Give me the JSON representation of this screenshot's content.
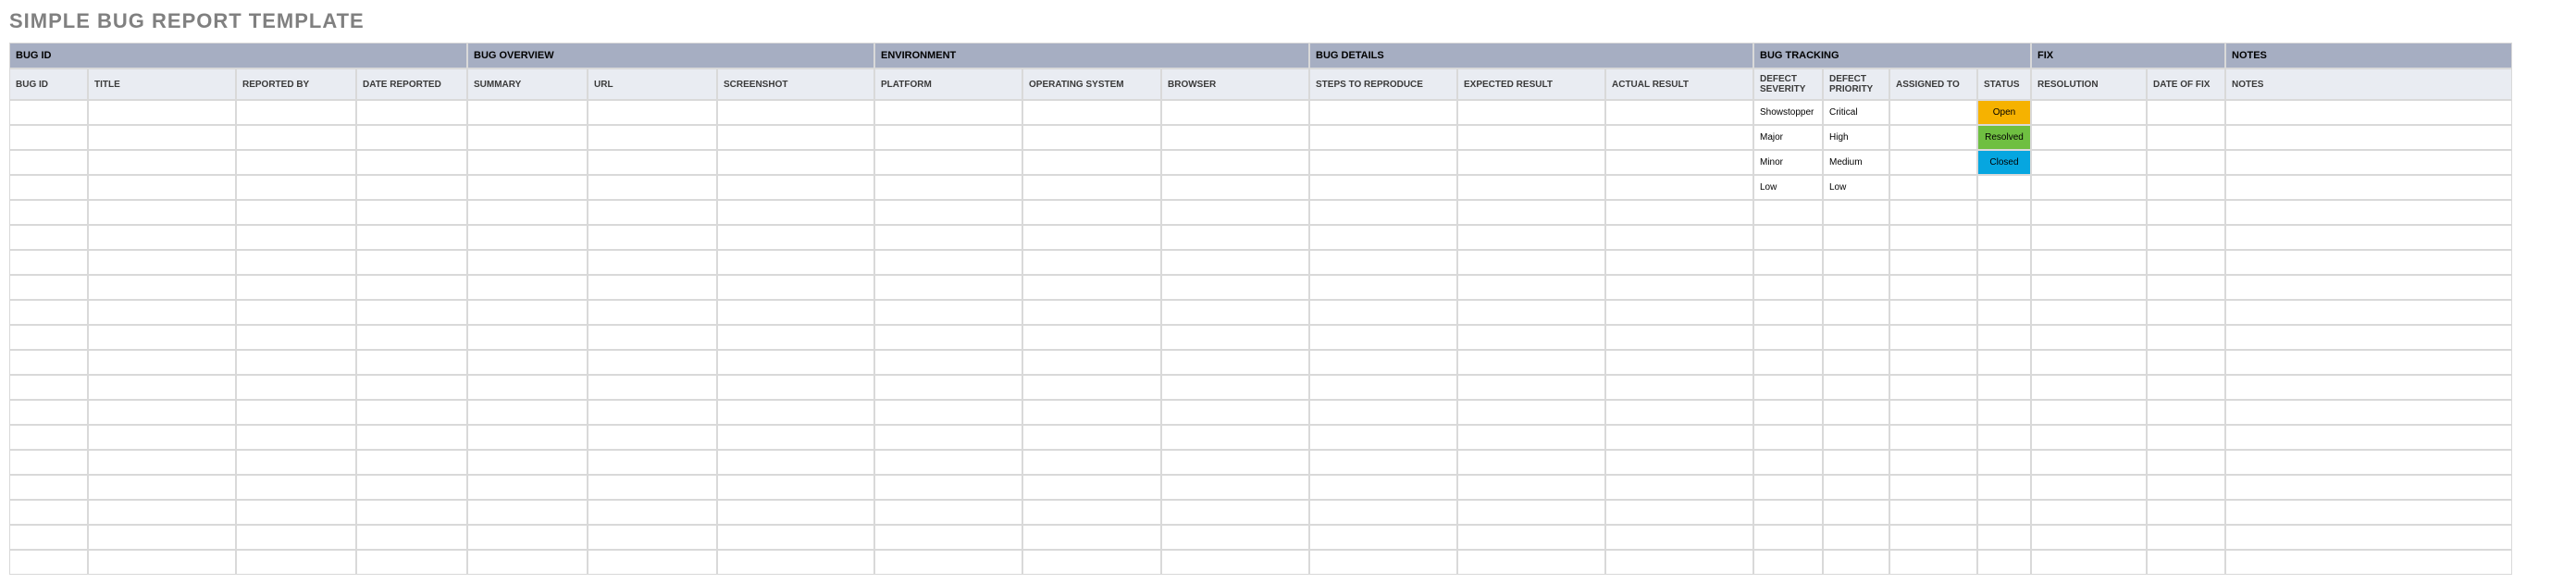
{
  "title": "SIMPLE BUG REPORT TEMPLATE",
  "groupHeaders": {
    "bugId": "BUG ID",
    "bugOverview": "BUG OVERVIEW",
    "environment": "ENVIRONMENT",
    "bugDetails": "BUG DETAILS",
    "bugTracking": "BUG TRACKING",
    "fix": "FIX",
    "notes": "NOTES"
  },
  "columnHeaders": {
    "bugId": "BUG ID",
    "title": "TITLE",
    "reportedBy": "REPORTED BY",
    "dateReported": "DATE REPORTED",
    "summary": "SUMMARY",
    "url": "URL",
    "screenshot": "SCREENSHOT",
    "platform": "PLATFORM",
    "operatingSystem": "OPERATING SYSTEM",
    "browser": "BROWSER",
    "stepsToReproduce": "STEPS TO REPRODUCE",
    "expectedResult": "EXPECTED RESULT",
    "actualResult": "ACTUAL RESULT",
    "defectSeverity": "DEFECT SEVERITY",
    "defectPriority": "DEFECT PRIORITY",
    "assignedTo": "ASSIGNED TO",
    "status": "STATUS",
    "resolution": "RESOLUTION",
    "dateOfFix": "DATE OF FIX",
    "notes": "NOTES"
  },
  "rows": [
    {
      "defectSeverity": "Showstopper",
      "defectPriority": "Critical",
      "status": "Open",
      "statusClass": "status-open"
    },
    {
      "defectSeverity": "Major",
      "defectPriority": "High",
      "status": "Resolved",
      "statusClass": "status-resolved"
    },
    {
      "defectSeverity": "Minor",
      "defectPriority": "Medium",
      "status": "Closed",
      "statusClass": "status-closed"
    },
    {
      "defectSeverity": "Low",
      "defectPriority": "Low",
      "status": "",
      "statusClass": ""
    },
    {},
    {},
    {},
    {},
    {},
    {},
    {},
    {},
    {},
    {},
    {},
    {},
    {},
    {},
    {}
  ]
}
